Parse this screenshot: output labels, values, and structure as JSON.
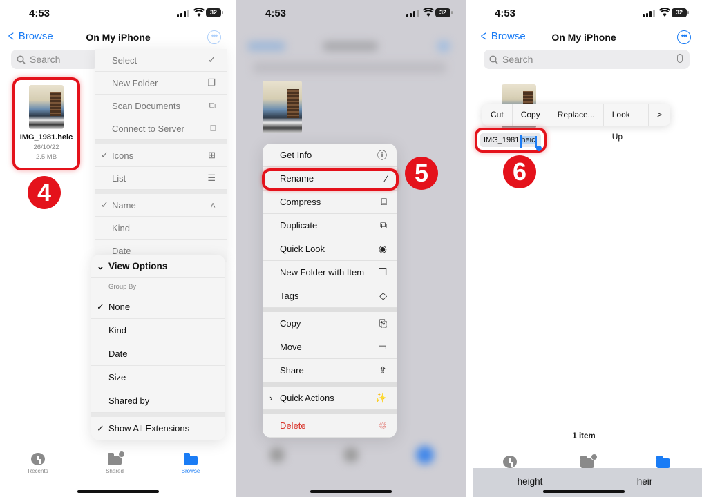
{
  "status_bar": {
    "time": "4:53",
    "battery": "32"
  },
  "nav": {
    "back_label": "Browse",
    "title": "On My iPhone"
  },
  "search": {
    "placeholder": "Search"
  },
  "file": {
    "name": "IMG_1981.heic",
    "date": "26/10/22",
    "size": "2.5 MB"
  },
  "steps": {
    "step1": "4",
    "step2": "5",
    "step3": "6"
  },
  "panel1": {
    "menu": [
      {
        "label": "Select",
        "icon": "checkmark-circle-icon",
        "glyph": "✓"
      },
      {
        "label": "New Folder",
        "icon": "folder-badge-plus-icon",
        "glyph": "❐"
      },
      {
        "label": "Scan Documents",
        "icon": "doc-viewfinder-icon",
        "glyph": "⧉"
      },
      {
        "label": "Connect to Server",
        "icon": "display-icon",
        "glyph": "⎕"
      },
      {
        "label": "Icons",
        "icon": "square-grid-icon",
        "glyph": "⊞",
        "checked": true
      },
      {
        "label": "List",
        "icon": "list-bullet-icon",
        "glyph": "☰"
      },
      {
        "label": "Name",
        "icon": "chevron-up-icon",
        "glyph": "˄",
        "checked": true
      },
      {
        "label": "Kind"
      },
      {
        "label": "Date"
      }
    ],
    "view_options": {
      "header": "View Options",
      "group_by_label": "Group By:",
      "options": [
        "None",
        "Kind",
        "Date",
        "Size",
        "Shared by"
      ],
      "selected": "None",
      "show_all_extensions": "Show All Extensions"
    }
  },
  "tabbar": {
    "recents": "Recents",
    "shared": "Shared",
    "browse": "Browse"
  },
  "panel2": {
    "context_menu": [
      {
        "label": "Get Info",
        "icon": "info-circle-icon",
        "glyph": "ⓘ"
      },
      {
        "label": "Rename",
        "icon": "pencil-icon",
        "glyph": "∕"
      },
      {
        "label": "Compress",
        "icon": "archivebox-icon",
        "glyph": "⌸"
      },
      {
        "label": "Duplicate",
        "icon": "plus-square-on-square-icon",
        "glyph": "⧉"
      },
      {
        "label": "Quick Look",
        "icon": "eye-icon",
        "glyph": "◉"
      },
      {
        "label": "New Folder with Item",
        "icon": "folder-badge-plus-icon",
        "glyph": "❐"
      },
      {
        "label": "Tags",
        "icon": "tag-icon",
        "glyph": "◇"
      },
      {
        "label": "Copy",
        "icon": "doc-on-doc-icon",
        "glyph": "⎘"
      },
      {
        "label": "Move",
        "icon": "folder-icon",
        "glyph": "▭"
      },
      {
        "label": "Share",
        "icon": "square-and-arrow-up-icon",
        "glyph": "⇪"
      },
      {
        "label": "Quick Actions",
        "icon": "wand-sparkles-icon",
        "glyph": "✨"
      },
      {
        "label": "Delete",
        "icon": "trash-icon",
        "glyph": "♲"
      }
    ]
  },
  "panel3": {
    "edit_menu": [
      "Cut",
      "Copy",
      "Replace...",
      "Look Up"
    ],
    "rename_base": "IMG_1981.",
    "rename_selected": "heic",
    "item_count": "1 item",
    "suggestions": [
      "height",
      "heir"
    ]
  },
  "colors": {
    "accent": "#1a7cf5",
    "highlight": "#e4121b",
    "destructive": "#d9342b"
  }
}
